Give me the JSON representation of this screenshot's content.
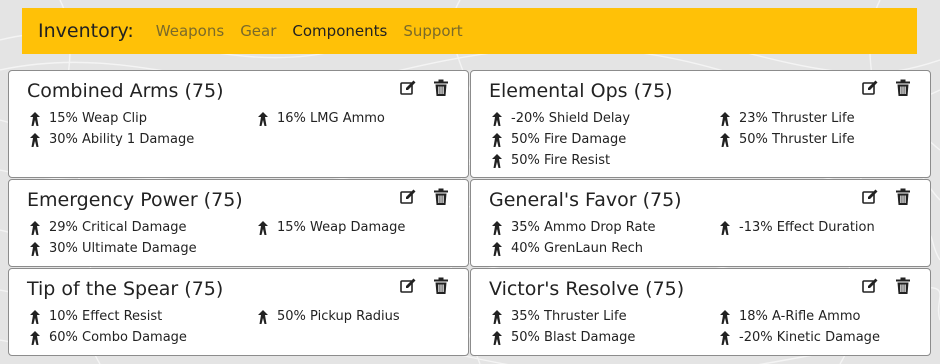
{
  "nav": {
    "brand": "Inventory:",
    "links": [
      {
        "label": "Weapons",
        "active": false
      },
      {
        "label": "Gear",
        "active": false
      },
      {
        "label": "Components",
        "active": true
      },
      {
        "label": "Support",
        "active": false
      }
    ]
  },
  "colors": {
    "navbar": "#ffc107",
    "card_border": "#8c8c8c"
  },
  "cards": [
    {
      "title": "Combined Arms (75)",
      "perks": [
        "15% Weap Clip",
        "16% LMG Ammo",
        "30% Ability 1 Damage"
      ]
    },
    {
      "title": "Elemental Ops (75)",
      "perks": [
        "-20% Shield Delay",
        "23% Thruster Life",
        "50% Fire Damage",
        "50% Thruster Life",
        "50% Fire Resist"
      ]
    },
    {
      "title": "Emergency Power (75)",
      "perks": [
        "29% Critical Damage",
        "15% Weap Damage",
        "30% Ultimate Damage"
      ]
    },
    {
      "title": "General's Favor (75)",
      "perks": [
        "35% Ammo Drop Rate",
        "-13% Effect Duration",
        "40% GrenLaun Rech"
      ]
    },
    {
      "title": "Tip of the Spear (75)",
      "perks": [
        "10% Effect Resist",
        "50% Pickup Radius",
        "60% Combo Damage"
      ]
    },
    {
      "title": "Victor's Resolve (75)",
      "perks": [
        "35% Thruster Life",
        "18% A-Rifle Ammo",
        "50% Blast Damage",
        "-20% Kinetic Damage"
      ]
    }
  ]
}
